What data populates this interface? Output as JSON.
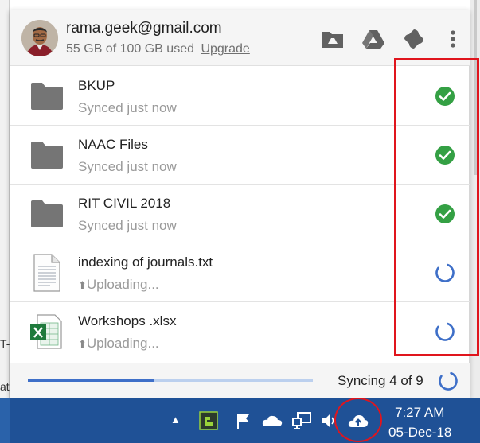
{
  "account": {
    "email": "rama.geek@gmail.com",
    "quota": "55 GB of 100 GB used",
    "upgrade_label": "Upgrade"
  },
  "header_icons": [
    "drive-folder-icon",
    "google-drive-icon",
    "google-photos-icon",
    "more-vert-icon"
  ],
  "items": [
    {
      "name": "BKUP",
      "status": "Synced just now",
      "icon": "folder-icon",
      "state": "synced"
    },
    {
      "name": "NAAC Files",
      "status": "Synced just now",
      "icon": "folder-icon",
      "state": "synced"
    },
    {
      "name": "RIT CIVIL 2018",
      "status": "Synced just now",
      "icon": "folder-icon",
      "state": "synced"
    },
    {
      "name": "indexing of journals.txt",
      "status": "Uploading...",
      "icon": "text-file-icon",
      "state": "uploading"
    },
    {
      "name": "Workshops .xlsx",
      "status": "Uploading...",
      "icon": "excel-file-icon",
      "state": "uploading"
    }
  ],
  "footer": {
    "sync_status": "Syncing 4 of 9",
    "progress": 0.44
  },
  "taskbar": {
    "time": "7:27 AM",
    "date": "05-Dec-18"
  },
  "colors": {
    "check_green": "#34a044",
    "spinner_blue": "#3e6fc8",
    "annotation_red": "#e0151d",
    "taskbar_blue": "#1f5196"
  }
}
